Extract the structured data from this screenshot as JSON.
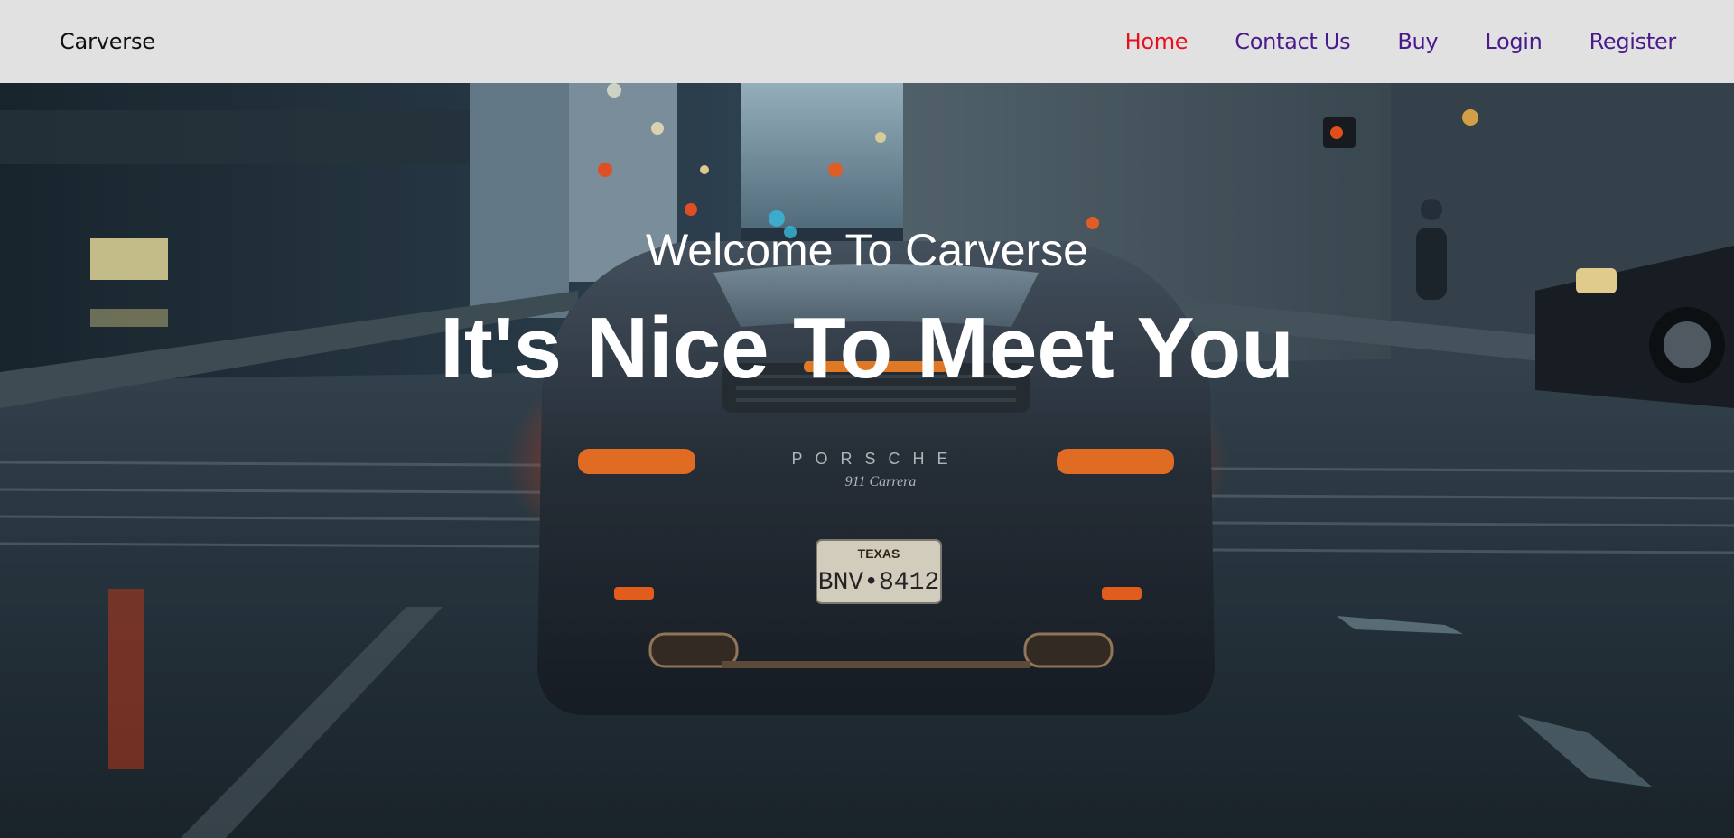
{
  "navbar": {
    "brand": "Carverse",
    "links": [
      {
        "label": "Home",
        "active": true
      },
      {
        "label": "Contact Us",
        "active": false
      },
      {
        "label": "Buy",
        "active": false
      },
      {
        "label": "Login",
        "active": false
      },
      {
        "label": "Register",
        "active": false
      }
    ]
  },
  "hero": {
    "welcome": "Welcome To Carverse",
    "tagline": "It's Nice To Meet You",
    "image_description_icon": "car-photo",
    "plate_state": "TEXAS",
    "plate_number": "BNV•8412",
    "badge": "PORSCHE",
    "model": "911 Carrera"
  },
  "colors": {
    "nav_bg": "#e1e1e1",
    "link": "#4a1a8c",
    "link_active": "#e8101c",
    "hero_text": "#ffffff"
  }
}
